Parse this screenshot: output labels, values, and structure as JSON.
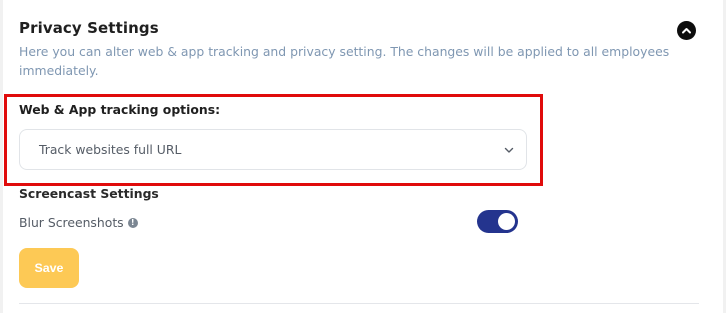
{
  "section": {
    "title": "Privacy Settings",
    "description": "Here you can alter web & app tracking and privacy setting. The changes will be applied to all employees immediately.",
    "collapse_icon": "chevron-up-icon"
  },
  "tracking": {
    "label": "Web & App tracking options:",
    "selected_value": "Track websites full URL",
    "chevron_icon": "chevron-down-icon"
  },
  "screencast": {
    "heading": "Screencast Settings",
    "blur_label": "Blur Screenshots",
    "info_icon": "info-icon",
    "blur_enabled": true
  },
  "actions": {
    "save_label": "Save"
  },
  "colors": {
    "toggle_on": "#24348e",
    "save_button": "#fdc955",
    "highlight_border": "#e00b0b",
    "description_text": "#7f97b2"
  }
}
